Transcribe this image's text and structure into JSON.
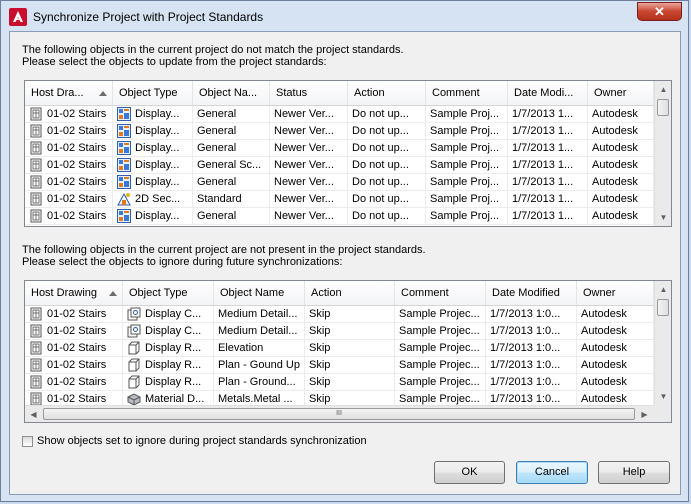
{
  "window": {
    "title": "Synchronize Project with Project Standards",
    "close_glyph": "✕"
  },
  "intro1": {
    "line1": "The following objects in the current project do not match the project standards.",
    "line2": "Please select the objects to update from the project standards:"
  },
  "grid1": {
    "columns": [
      "Host Dra...",
      "Object Type",
      "Object Na...",
      "Status",
      "Action",
      "Comment",
      "Date Modi...",
      "Owner"
    ],
    "rows": [
      {
        "host": "01-02 Stairs",
        "type": "Display...",
        "type_icon": "display-theme-icon",
        "name": "General",
        "status": "Newer Ver...",
        "action": "Do not up...",
        "comment": "Sample Proj...",
        "date": "1/7/2013 1...",
        "owner": "Autodesk"
      },
      {
        "host": "01-02 Stairs",
        "type": "Display...",
        "type_icon": "display-theme-icon",
        "name": "General",
        "status": "Newer Ver...",
        "action": "Do not up...",
        "comment": "Sample Proj...",
        "date": "1/7/2013 1...",
        "owner": "Autodesk"
      },
      {
        "host": "01-02 Stairs",
        "type": "Display...",
        "type_icon": "display-theme-icon",
        "name": "General",
        "status": "Newer Ver...",
        "action": "Do not up...",
        "comment": "Sample Proj...",
        "date": "1/7/2013 1...",
        "owner": "Autodesk"
      },
      {
        "host": "01-02 Stairs",
        "type": "Display...",
        "type_icon": "display-theme-icon",
        "name": "General Sc...",
        "status": "Newer Ver...",
        "action": "Do not up...",
        "comment": "Sample Proj...",
        "date": "1/7/2013 1...",
        "owner": "Autodesk"
      },
      {
        "host": "01-02 Stairs",
        "type": "Display...",
        "type_icon": "display-theme-icon",
        "name": "General",
        "status": "Newer Ver...",
        "action": "Do not up...",
        "comment": "Sample Proj...",
        "date": "1/7/2013 1...",
        "owner": "Autodesk"
      },
      {
        "host": "01-02 Stairs",
        "type": "2D Sec...",
        "type_icon": "section-style-icon",
        "name": "Standard",
        "status": "Newer Ver...",
        "action": "Do not up...",
        "comment": "Sample Proj...",
        "date": "1/7/2013 1...",
        "owner": "Autodesk"
      },
      {
        "host": "01-02 Stairs",
        "type": "Display...",
        "type_icon": "display-theme-icon",
        "name": "General",
        "status": "Newer Ver...",
        "action": "Do not up...",
        "comment": "Sample Proj...",
        "date": "1/7/2013 1...",
        "owner": "Autodesk"
      }
    ]
  },
  "intro2": {
    "line1": "The following objects in the current project are not present in the project standards.",
    "line2": "Please select the objects to ignore during future synchronizations:"
  },
  "grid2": {
    "columns": [
      "Host Drawing",
      "Object Type",
      "Object Name",
      "Action",
      "Comment",
      "Date Modified",
      "Owner"
    ],
    "rows": [
      {
        "host": "01-02 Stairs",
        "type": "Display C...",
        "type_icon": "display-config-icon",
        "name": "Medium Detail...",
        "action": "Skip",
        "comment": "Sample Projec...",
        "date": "1/7/2013 1:0...",
        "owner": "Autodesk"
      },
      {
        "host": "01-02 Stairs",
        "type": "Display C...",
        "type_icon": "display-config-icon",
        "name": "Medium Detail...",
        "action": "Skip",
        "comment": "Sample Projec...",
        "date": "1/7/2013 1:0...",
        "owner": "Autodesk"
      },
      {
        "host": "01-02 Stairs",
        "type": "Display R...",
        "type_icon": "display-rep-icon",
        "name": "Elevation",
        "action": "Skip",
        "comment": "Sample Projec...",
        "date": "1/7/2013 1:0...",
        "owner": "Autodesk"
      },
      {
        "host": "01-02 Stairs",
        "type": "Display R...",
        "type_icon": "display-rep-icon",
        "name": "Plan - Gound Up",
        "action": "Skip",
        "comment": "Sample Projec...",
        "date": "1/7/2013 1:0...",
        "owner": "Autodesk"
      },
      {
        "host": "01-02 Stairs",
        "type": "Display R...",
        "type_icon": "display-rep-icon",
        "name": "Plan - Ground...",
        "action": "Skip",
        "comment": "Sample Projec...",
        "date": "1/7/2013 1:0...",
        "owner": "Autodesk"
      },
      {
        "host": "01-02 Stairs",
        "type": "Material D...",
        "type_icon": "material-icon",
        "name": "Metals.Metal ...",
        "action": "Skip",
        "comment": "Sample Projec...",
        "date": "1/7/2013 1:0...",
        "owner": "Autodesk"
      }
    ]
  },
  "show_ignored": {
    "label": "Show objects set to ignore during project standards synchronization",
    "checked": false
  },
  "buttons": {
    "ok": "OK",
    "cancel": "Cancel",
    "help": "Help"
  },
  "scroll": {
    "up": "▲",
    "down": "▼",
    "left": "◀",
    "right": "▶",
    "grip": "III"
  },
  "colors": {
    "accent": "#3c7fb1",
    "close": "#c9462f",
    "app_icon": "#c8102e"
  }
}
